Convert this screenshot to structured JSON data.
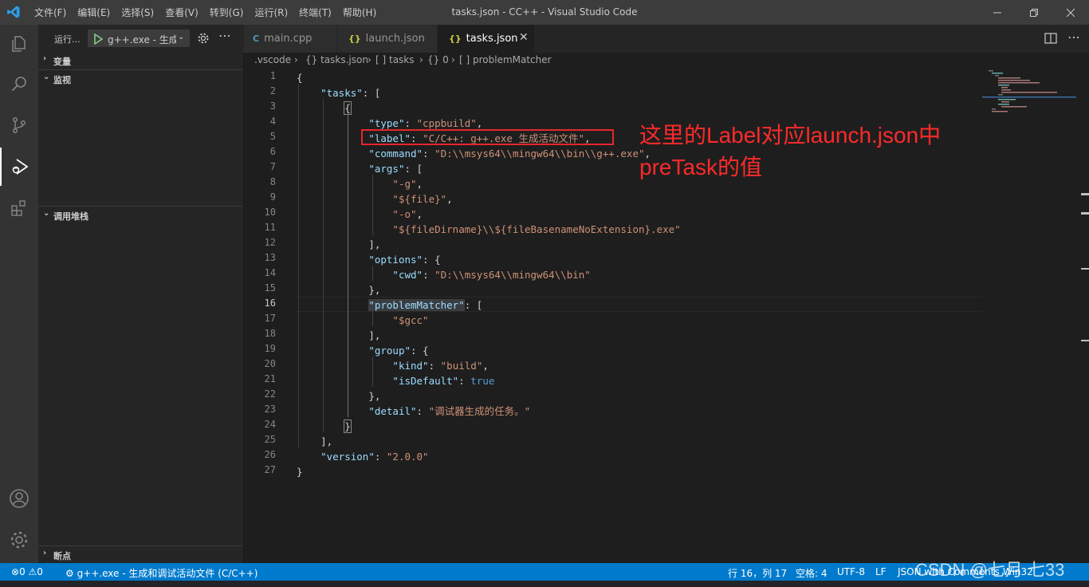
{
  "window": {
    "title": "tasks.json - CC++ - Visual Studio Code",
    "menu": [
      "文件(F)",
      "编辑(E)",
      "选择(S)",
      "查看(V)",
      "转到(G)",
      "运行(R)",
      "终端(T)",
      "帮助(H)"
    ]
  },
  "sidebar": {
    "run_label": "运行...",
    "config_select": "g++.exe - 生成",
    "sections": {
      "variables": "变量",
      "watch": "监视",
      "callstack": "调用堆栈",
      "breakpoints": "断点"
    }
  },
  "tabs": [
    {
      "label": "main.cpp",
      "icon": "C"
    },
    {
      "label": "launch.json",
      "icon": "{}"
    },
    {
      "label": "tasks.json",
      "icon": "{}",
      "active": true
    }
  ],
  "breadcrumb": [
    ".vscode",
    "{} tasks.json",
    "[ ] tasks",
    "{} 0",
    "[ ] problemMatcher"
  ],
  "editor": {
    "current_line": 16,
    "line_numbers": [
      "1",
      "2",
      "3",
      "4",
      "5",
      "6",
      "7",
      "8",
      "9",
      "10",
      "11",
      "12",
      "13",
      "14",
      "15",
      "16",
      "17",
      "18",
      "19",
      "20",
      "21",
      "22",
      "23",
      "24",
      "25",
      "26",
      "27"
    ]
  },
  "annotation": {
    "line1": "这里的Label对应launch.json中",
    "line2": "preTask的值"
  },
  "statusbar": {
    "errors": "0",
    "warnings": "0",
    "debug_config": "g++.exe - 生成和调试活动文件 (C/C++)",
    "position": "行 16，列 17",
    "spaces": "空格: 4",
    "encoding": "UTF-8",
    "eol": "LF",
    "language": "JSON with Comments",
    "platform": "Win32"
  },
  "watermark": "CSDN @七月 七33",
  "colors": {
    "statusbar": "#007acc",
    "annotation": "#ff2a2a",
    "json_key": "#9cdcfe",
    "json_string": "#ce9178",
    "json_bool": "#569cd6"
  }
}
